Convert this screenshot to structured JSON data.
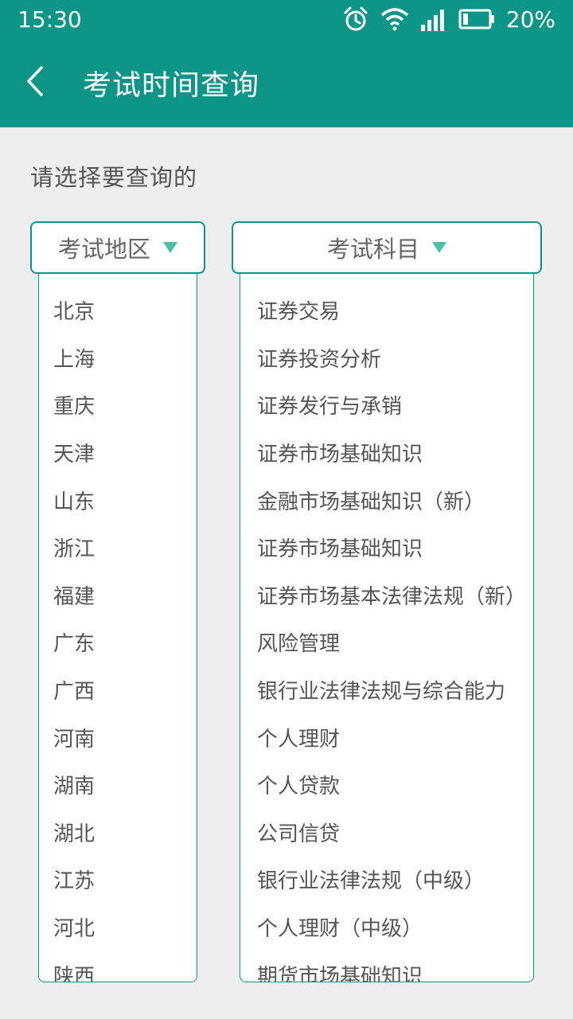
{
  "status_bar": {
    "time": "15:30",
    "battery_text": "20%",
    "icons": [
      "alarm-icon",
      "wifi-icon",
      "signal-icon",
      "battery-icon"
    ]
  },
  "header": {
    "title": "考试时间查询",
    "back_icon": "chevron-left-icon"
  },
  "prompt": "请选择要查询的",
  "selectors": {
    "region_label": "考试地区",
    "subject_label": "考试科目"
  },
  "regions": [
    "北京",
    "上海",
    "重庆",
    "天津",
    "山东",
    "浙江",
    "福建",
    "广东",
    "广西",
    "河南",
    "湖南",
    "湖北",
    "江苏",
    "河北",
    "陕西"
  ],
  "subjects": [
    "证券交易",
    "证券投资分析",
    "证券发行与承销",
    "证券市场基础知识",
    "金融市场基础知识（新）",
    "证券市场基础知识",
    "证券市场基本法律法规（新）",
    "风险管理",
    "银行业法律法规与综合能力",
    "个人理财",
    "个人贷款",
    "公司信贷",
    "银行业法律法规（中级）",
    "个人理财（中级）",
    "期货市场基础知识"
  ],
  "colors": {
    "primary": "#0d9688",
    "accent_triangle": "#4cbfa9",
    "background": "#eeeeee"
  }
}
